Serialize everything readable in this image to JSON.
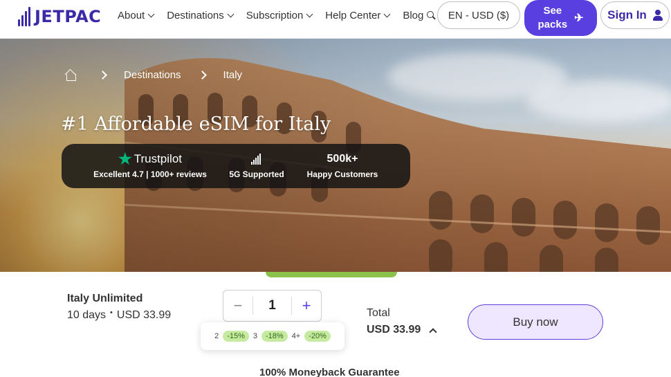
{
  "header": {
    "logo_text": "JETPAC",
    "nav": [
      {
        "label": "About",
        "has_dropdown": true
      },
      {
        "label": "Destinations",
        "has_dropdown": true
      },
      {
        "label": "Subscription",
        "has_dropdown": true
      },
      {
        "label": "Help Center",
        "has_dropdown": true
      },
      {
        "label": "Blog",
        "has_dropdown": false
      }
    ],
    "language_currency": "EN - USD ($)",
    "see_packs_line1": "See",
    "see_packs_line2": "packs",
    "sign_in": "Sign In",
    "accent_color": "#5a3fe0",
    "logo_color": "#3b2aa8"
  },
  "hero": {
    "breadcrumb": {
      "items": [
        "Destinations",
        "Italy"
      ]
    },
    "title": "#1 Affordable eSIM for Italy",
    "stats": {
      "trustpilot": {
        "brand": "Trustpilot",
        "sub": "Excellent 4.7 | 1000+ reviews"
      },
      "network": {
        "sub": "5G Supported"
      },
      "customers": {
        "value": "500k+",
        "sub": "Happy Customers"
      }
    }
  },
  "purchase": {
    "product_name": "Italy Unlimited",
    "duration": "10 days",
    "price": "USD 33.99",
    "quantity": "1",
    "minus_label": "−",
    "plus_label": "+",
    "discounts": [
      {
        "qty": "2",
        "off": "-15%"
      },
      {
        "qty": "3",
        "off": "-18%"
      },
      {
        "qty": "4+",
        "off": "-20%"
      }
    ],
    "total_label": "Total",
    "total_value": "USD 33.99",
    "buy_label": "Buy now",
    "guarantee": "100% Moneyback Guarantee"
  }
}
